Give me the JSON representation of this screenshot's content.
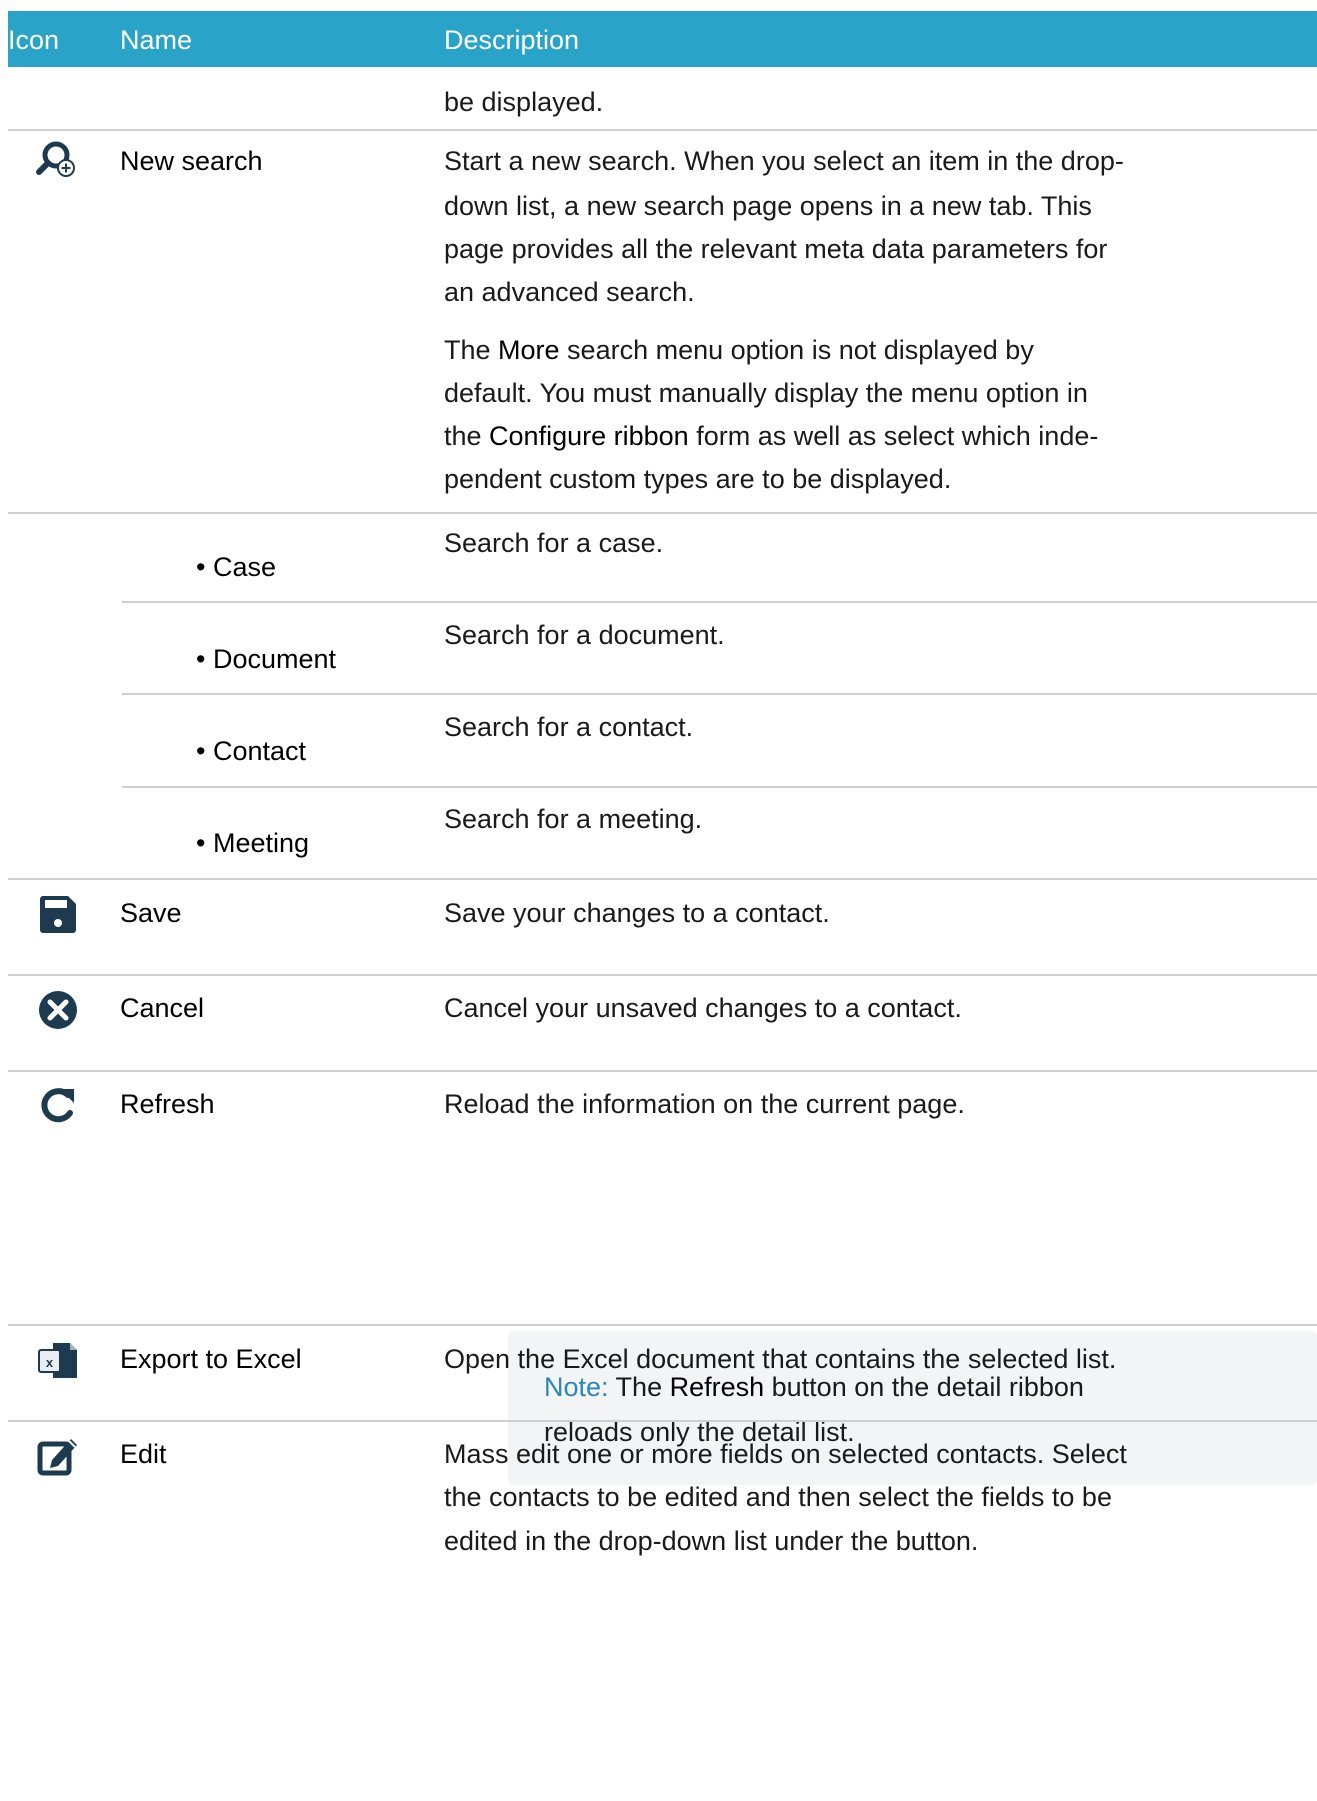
{
  "table": {
    "headers": {
      "icon": "Icon",
      "name": "Name",
      "description": "Description"
    },
    "continued_text": "be displayed.",
    "rows": {
      "new_search": {
        "icon": "search-plus-icon",
        "name": "New search",
        "desc_lines": [
          "Start a new search. When you select an item in the drop-",
          "down list, a new search page opens in a new tab. This",
          "page provides all the relevant meta data parameters for",
          "an advanced search."
        ],
        "para2": {
          "l1_pre": "The ",
          "l1_bold": "More",
          "l1_post": " search menu option is not displayed by",
          "l2": "default. You must manually display the menu option in",
          "l3_pre": "the ",
          "l3_bold": "Configure ribbon",
          "l3_post": " form as well as select which inde-",
          "l4": "pendent custom types are to be displayed."
        }
      },
      "case": {
        "name": "Case",
        "desc": "Search for a case."
      },
      "document": {
        "name": "Document",
        "desc": "Search for a document."
      },
      "contact": {
        "name": "Contact",
        "desc": "Search for a contact."
      },
      "meeting": {
        "name": "Meeting",
        "desc": "Search for a meeting."
      },
      "save": {
        "icon": "save-icon",
        "name": "Save",
        "desc": "Save your changes to a contact."
      },
      "cancel": {
        "icon": "cancel-icon",
        "name": "Cancel",
        "desc": "Cancel your unsaved changes to a contact."
      },
      "refresh": {
        "icon": "refresh-icon",
        "name": "Refresh",
        "desc": "Reload the information on the current page.",
        "note": {
          "label": "Note:",
          "l1_pre": " The ",
          "l1_bold": "Refresh",
          "l1_post": " button on the detail ribbon",
          "l2": "reloads only the detail list."
        }
      },
      "export": {
        "icon": "excel-icon",
        "name": "Export to Excel",
        "desc": "Open the Excel document that contains the selected list."
      },
      "edit": {
        "icon": "edit-icon",
        "name": "Edit",
        "desc_lines": [
          "Mass edit one or more fields on selected contacts. Select",
          "the contacts to be edited and then select the fields to be",
          "edited in the drop-down list under the button."
        ]
      }
    },
    "colors": {
      "header_bg": "#2aa3c8",
      "note_bg": "#f3f4f6",
      "note_label": "#2d86b8",
      "icon": "#1d3a4e"
    }
  }
}
